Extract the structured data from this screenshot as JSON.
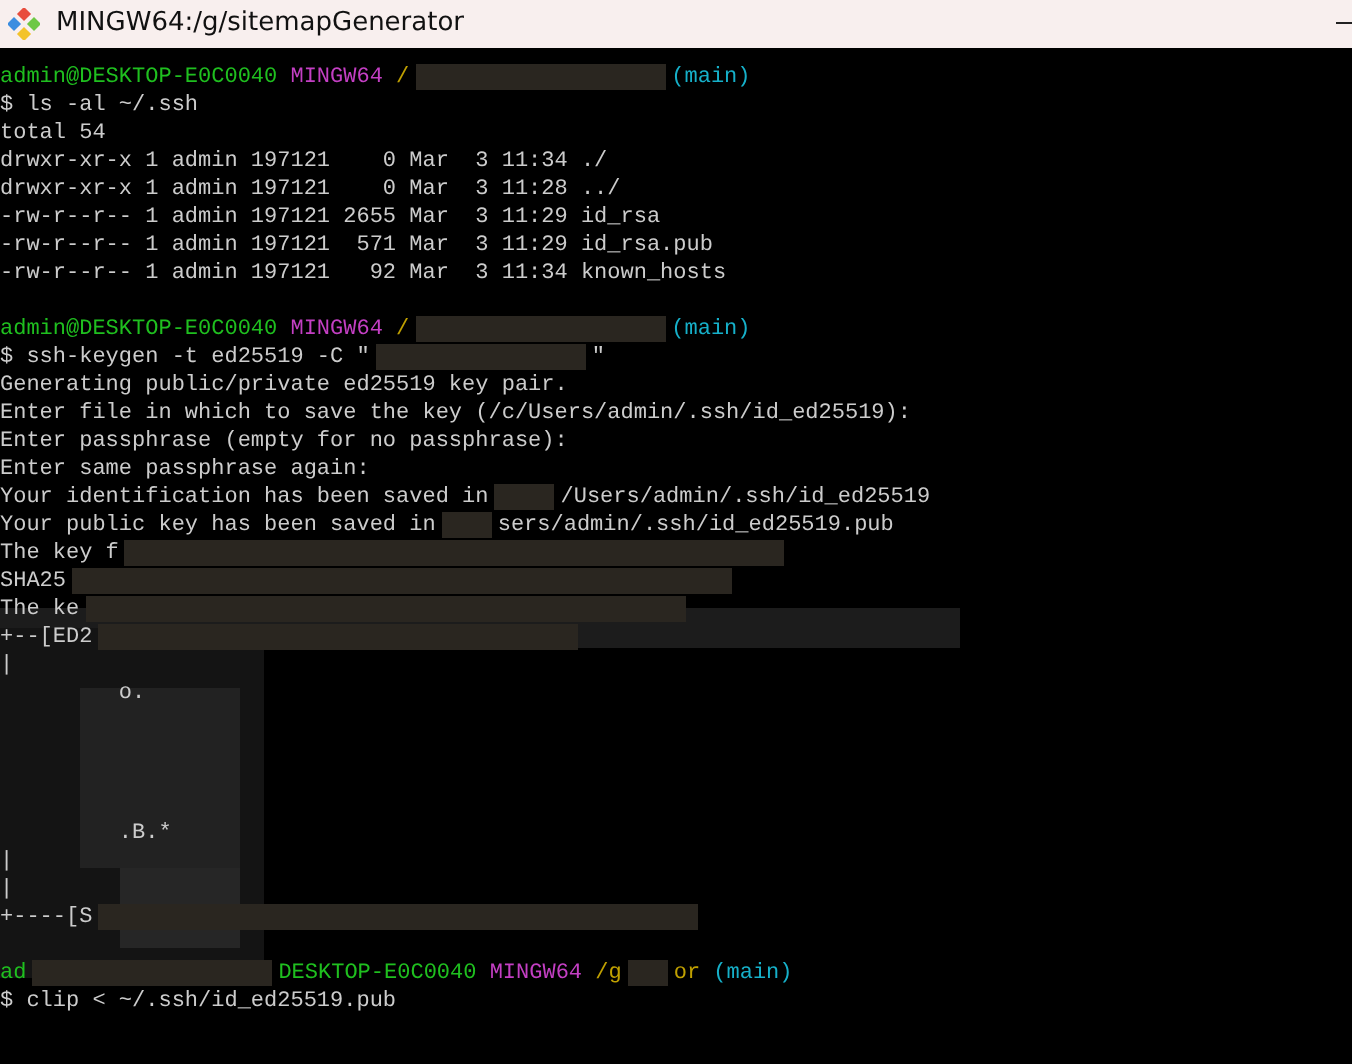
{
  "window": {
    "title": "MINGW64:/g/sitemapGenerator"
  },
  "lines": [
    {
      "kind": "text",
      "segments": [
        {
          "kind": "user",
          "text": "admin@DESKTOP-E0C0040"
        },
        {
          "kind": "shell",
          "text": "MINGW64"
        },
        {
          "kind": "path",
          "text": "/"
        },
        {
          "kind": "redaction"
        },
        {
          "kind": "branch",
          "text": "(main)"
        }
      ]
    },
    {
      "kind": "text",
      "segments": [
        {
          "kind": "plain",
          "text": "$ ls -al ~/.ssh"
        }
      ]
    },
    {
      "kind": "text",
      "segments": [
        {
          "kind": "plain",
          "text": "total 54"
        }
      ]
    },
    {
      "kind": "text",
      "segments": [
        {
          "kind": "plain",
          "text": "drwxr-xr-x 1 admin 197121    0 Mar  3 11:34 ./"
        }
      ]
    },
    {
      "kind": "text",
      "segments": [
        {
          "kind": "plain",
          "text": "drwxr-xr-x 1 admin 197121    0 Mar  3 11:28 ../"
        }
      ]
    },
    {
      "kind": "text",
      "segments": [
        {
          "kind": "plain",
          "text": "-rw-r--r-- 1 admin 197121 2655 Mar  3 11:29 id_rsa"
        }
      ]
    },
    {
      "kind": "text",
      "segments": [
        {
          "kind": "plain",
          "text": "-rw-r--r-- 1 admin 197121  571 Mar  3 11:29 id_rsa.pub"
        }
      ]
    },
    {
      "kind": "text",
      "segments": [
        {
          "kind": "plain",
          "text": "-rw-r--r-- 1 admin 197121   92 Mar  3 11:34 known_hosts"
        }
      ]
    },
    {
      "kind": "blank"
    },
    {
      "kind": "text",
      "segments": [
        {
          "kind": "user",
          "text": "admin@DESKTOP-E0C0040"
        },
        {
          "kind": "shell",
          "text": "MINGW64"
        },
        {
          "kind": "path",
          "text": "/"
        },
        {
          "kind": "redaction"
        },
        {
          "kind": "branch",
          "text": "(main)"
        }
      ]
    },
    {
      "kind": "text",
      "segments": [
        {
          "kind": "plain",
          "text": "$ ssh-keygen -t ed25519 -C \""
        },
        {
          "kind": "redaction"
        },
        {
          "kind": "plain",
          "text": "\""
        }
      ]
    },
    {
      "kind": "text",
      "segments": [
        {
          "kind": "plain",
          "text": "Generating public/private ed25519 key pair."
        }
      ]
    },
    {
      "kind": "text",
      "segments": [
        {
          "kind": "plain",
          "text": "Enter file in which to save the key (/c/Users/admin/.ssh/id_ed25519):"
        }
      ]
    },
    {
      "kind": "text",
      "segments": [
        {
          "kind": "plain",
          "text": "Enter passphrase (empty for no passphrase):"
        }
      ]
    },
    {
      "kind": "text",
      "segments": [
        {
          "kind": "plain",
          "text": "Enter same passphrase again:"
        }
      ]
    },
    {
      "kind": "text",
      "segments": [
        {
          "kind": "plain",
          "text": "Your identification has been saved in"
        },
        {
          "kind": "redaction"
        },
        {
          "kind": "plain",
          "text": "/Users/admin/.ssh/id_ed25519"
        }
      ]
    },
    {
      "kind": "text",
      "segments": [
        {
          "kind": "plain",
          "text": "Your public key has been saved in"
        },
        {
          "kind": "redaction"
        },
        {
          "kind": "plain",
          "text": "sers/admin/.ssh/id_ed25519.pub"
        }
      ]
    },
    {
      "kind": "text",
      "segments": [
        {
          "kind": "plain",
          "text": "The key f"
        },
        {
          "kind": "redaction"
        }
      ]
    },
    {
      "kind": "text",
      "segments": [
        {
          "kind": "plain",
          "text": "SHA25"
        },
        {
          "kind": "redaction"
        }
      ]
    },
    {
      "kind": "text",
      "segments": [
        {
          "kind": "plain",
          "text": "The ke"
        },
        {
          "kind": "redaction"
        }
      ]
    },
    {
      "kind": "text",
      "segments": [
        {
          "kind": "plain",
          "text": "+--[ED2"
        },
        {
          "kind": "redaction"
        }
      ]
    },
    {
      "kind": "text",
      "segments": [
        {
          "kind": "plain",
          "text": "|"
        }
      ]
    },
    {
      "kind": "text",
      "segments": [
        {
          "kind": "plain",
          "text": "         o."
        }
      ]
    },
    {
      "kind": "blank"
    },
    {
      "kind": "blank"
    },
    {
      "kind": "blank"
    },
    {
      "kind": "blank"
    },
    {
      "kind": "text",
      "segments": [
        {
          "kind": "plain",
          "text": "         .B.*"
        }
      ]
    },
    {
      "kind": "text",
      "segments": [
        {
          "kind": "plain",
          "text": "|"
        }
      ]
    },
    {
      "kind": "text",
      "segments": [
        {
          "kind": "plain",
          "text": "|"
        }
      ]
    },
    {
      "kind": "text",
      "segments": [
        {
          "kind": "plain",
          "text": "+----[S"
        },
        {
          "kind": "redaction"
        }
      ]
    },
    {
      "kind": "blank"
    },
    {
      "kind": "text",
      "segments": [
        {
          "kind": "user",
          "text": "ad"
        },
        {
          "kind": "redaction"
        },
        {
          "kind": "user",
          "text": "DESKTOP-E0C0040"
        },
        {
          "kind": "shell",
          "text": "MINGW64"
        },
        {
          "kind": "path",
          "text": "/g"
        },
        {
          "kind": "redaction"
        },
        {
          "kind": "path",
          "text": "or"
        },
        {
          "kind": "branch",
          "text": "(main)"
        }
      ]
    },
    {
      "kind": "text",
      "segments": [
        {
          "kind": "plain",
          "text": "$ clip < ~/.ssh/id_ed25519.pub"
        }
      ]
    }
  ]
}
